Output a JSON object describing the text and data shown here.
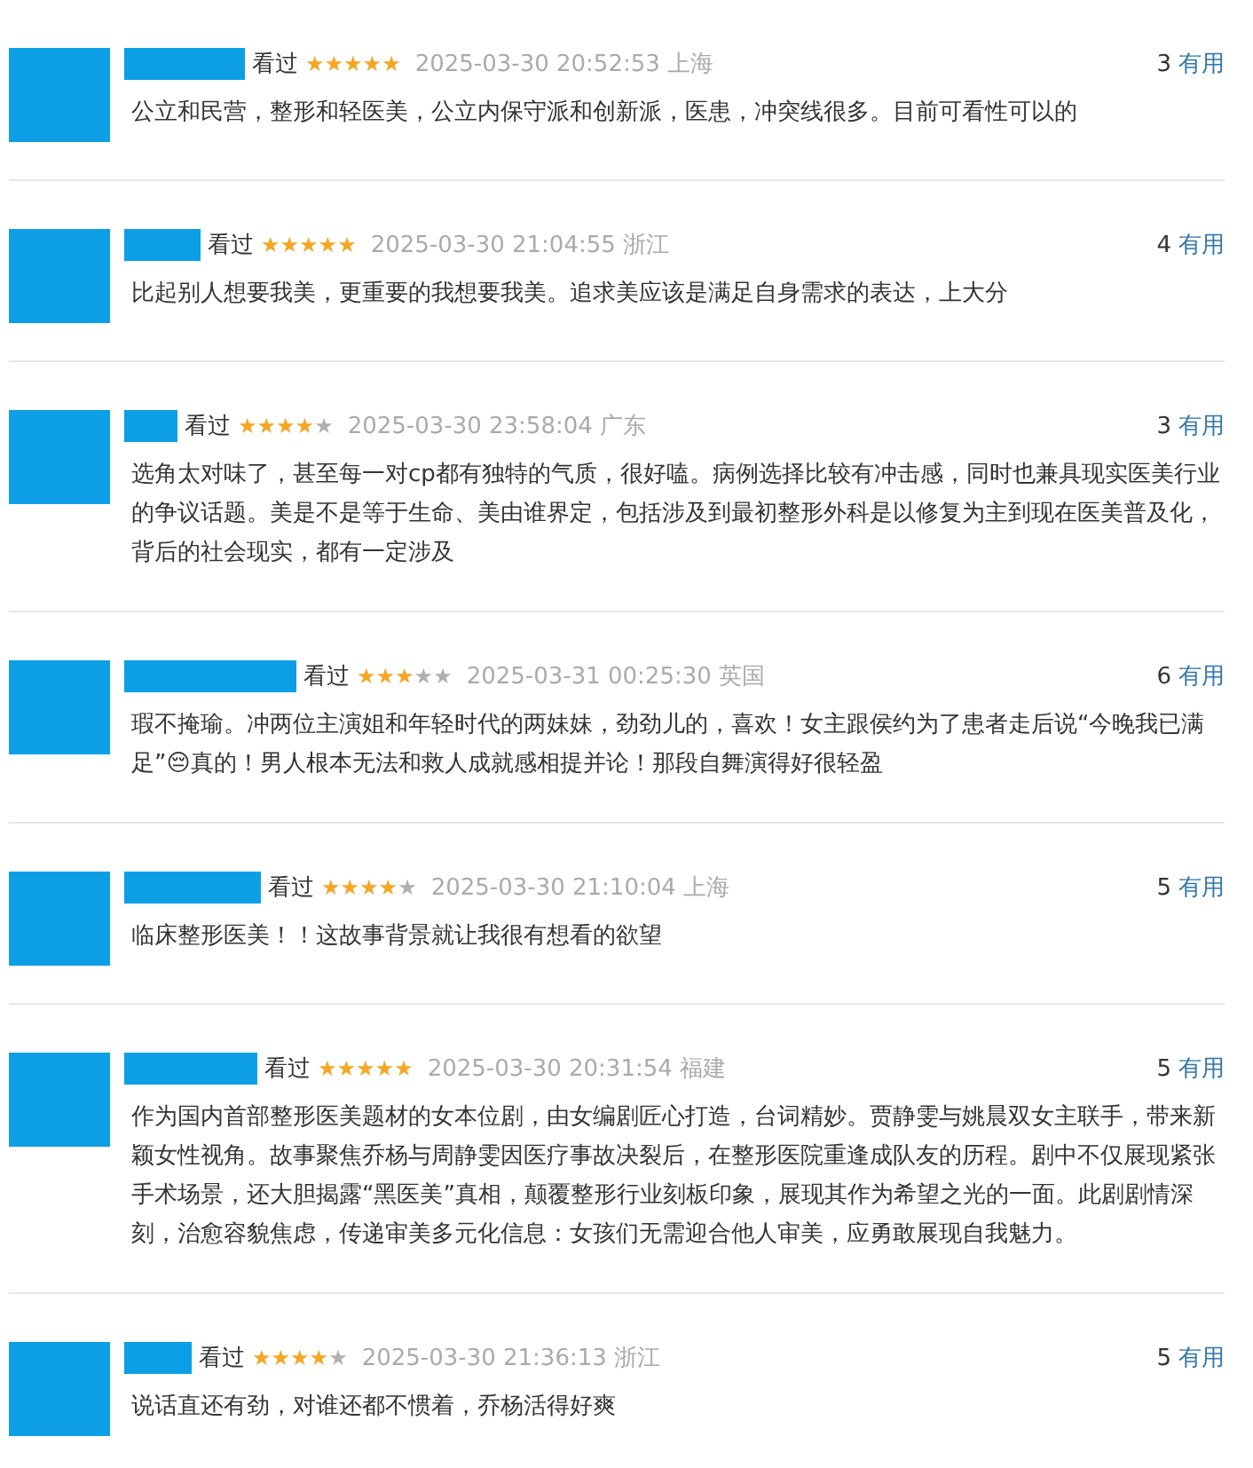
{
  "reviews": [
    {
      "status": "看过",
      "stars": 5,
      "time": "2025-03-30 20:52:53",
      "location": "上海",
      "votes": "3",
      "vote_label": "有用",
      "text": "公立和民营，整形和轻医美，公立内保守派和创新派，医患，冲突线很多。目前可看性可以的"
    },
    {
      "status": "看过",
      "stars": 5,
      "time": "2025-03-30 21:04:55",
      "location": "浙江",
      "votes": "4",
      "vote_label": "有用",
      "text": "比起别人想要我美，更重要的我想要我美。追求美应该是满足自身需求的表达，上大分"
    },
    {
      "status": "看过",
      "stars": 4,
      "time": "2025-03-30 23:58:04",
      "location": "广东",
      "votes": "3",
      "vote_label": "有用",
      "text": "选角太对味了，甚至每一对cp都有独特的气质，很好嗑。病例选择比较有冲击感，同时也兼具现实医美行业的争议话题。美是不是等于生命、美由谁界定，包括涉及到最初整形外科是以修复为主到现在医美普及化，背后的社会现实，都有一定涉及"
    },
    {
      "status": "看过",
      "stars": 3,
      "time": "2025-03-31 00:25:30",
      "location": "英国",
      "votes": "6",
      "vote_label": "有用",
      "text": "瑕不掩瑜。冲两位主演姐和年轻时代的两妹妹，劲劲儿的，喜欢！女主跟侯约为了患者走后说“今晚我已满足”😔真的！男人根本无法和救人成就感相提并论！那段自舞演得好很轻盈"
    },
    {
      "status": "看过",
      "stars": 4,
      "time": "2025-03-30 21:10:04",
      "location": "上海",
      "votes": "5",
      "vote_label": "有用",
      "text": "临床整形医美！！这故事背景就让我很有想看的欲望"
    },
    {
      "status": "看过",
      "stars": 5,
      "time": "2025-03-30 20:31:54",
      "location": "福建",
      "votes": "5",
      "vote_label": "有用",
      "text": "作为国内首部整形医美题材的女本位剧，由女编剧匠心打造，台词精妙。贾静雯与姚晨双女主联手，带来新颖女性视角。故事聚焦乔杨与周静雯因医疗事故决裂后，在整形医院重逢成队友的历程。剧中不仅展现紧张手术场景，还大胆揭露“黑医美”真相，颠覆整形行业刻板印象，展现其作为希望之光的一面。此剧剧情深刻，治愈容貌焦虑，传递审美多元化信息：女孩们无需迎合他人审美，应勇敢展现自我魅力。"
    },
    {
      "status": "看过",
      "stars": 4,
      "time": "2025-03-30 21:36:13",
      "location": "浙江",
      "votes": "5",
      "vote_label": "有用",
      "text": "说话直还有劲，对谁还都不惯着，乔杨活得好爽"
    }
  ]
}
